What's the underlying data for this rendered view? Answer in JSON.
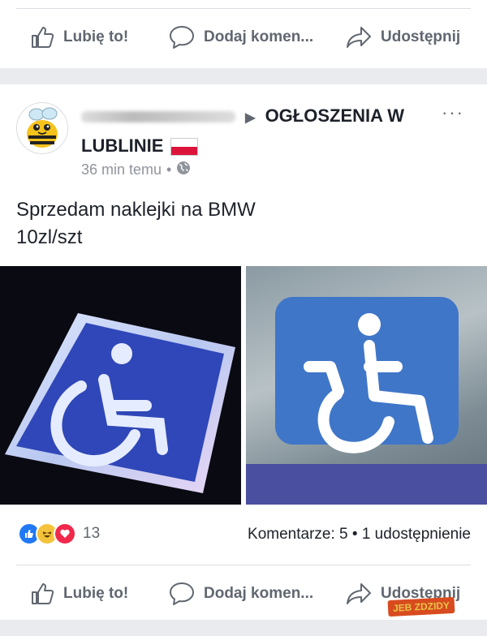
{
  "top_actions": {
    "like": "Lubię to!",
    "comment": "Dodaj komen...",
    "share": "Udostępnij"
  },
  "post": {
    "group_name": "OGŁOSZENIA W LUBLINIE",
    "time": "36 min temu",
    "dot": "•",
    "more": "···",
    "text_line1": "Sprzedam naklejki na BMW",
    "text_line2": "10zl/szt",
    "reactions_count": "13",
    "comments_shares": "Komentarze: 5 • 1 udostępnienie"
  },
  "bottom_actions": {
    "like": "Lubię to!",
    "comment": "Dodaj komen...",
    "share": "Udostępnij"
  },
  "watermark": {
    "part1": "JEB",
    "part2": "ZDZIDY"
  },
  "colors": {
    "sign_blue": "#2f5fb3",
    "like_blue": "#2078f4",
    "haha_yellow": "#f5c33b",
    "love_red": "#f0284a"
  }
}
